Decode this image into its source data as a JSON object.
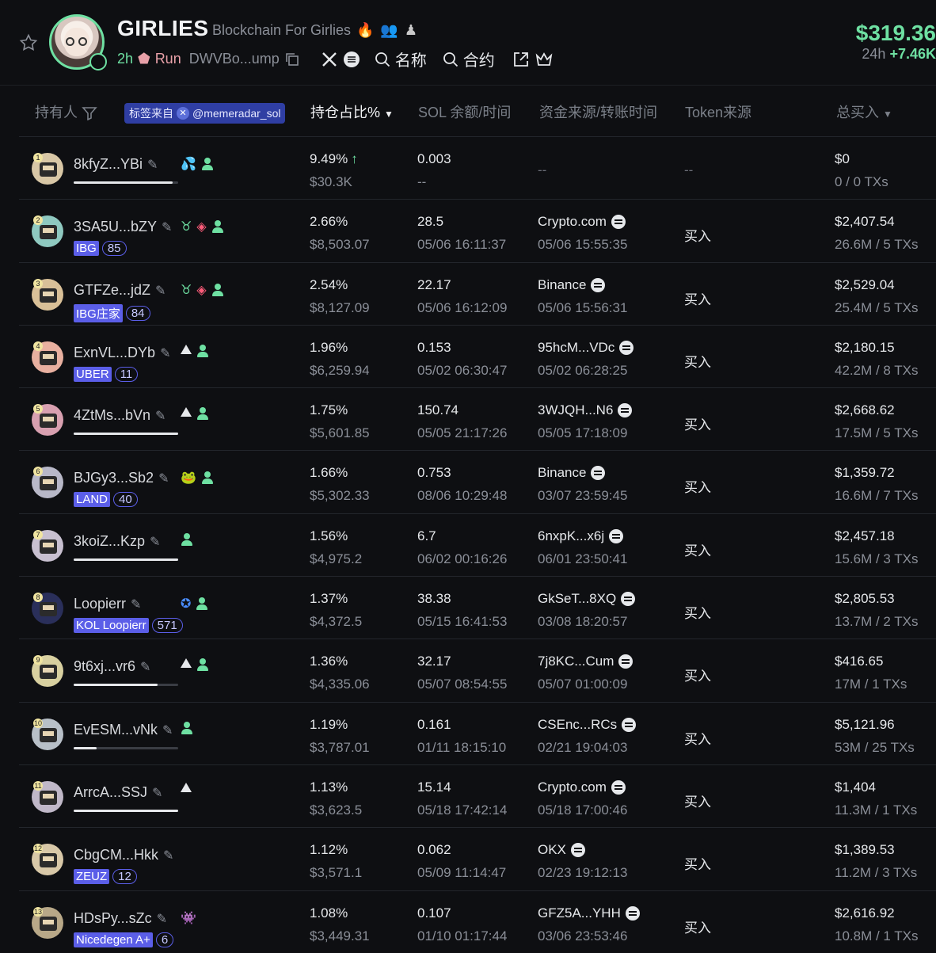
{
  "token": {
    "symbol": "GIRLIES",
    "full_name": "Blockchain For Girlies",
    "age": "2h",
    "run_label": "Run",
    "address": "DWVBo...ump",
    "search_name": "名称",
    "search_contract": "合约",
    "price": "$319.36",
    "change_label": "24h",
    "change_value": "+7.46K"
  },
  "columns": {
    "holder": "持有人",
    "tag_source": "标签来自",
    "tag_account": "@memeradar_sol",
    "holding_pct": "持仓占比%",
    "sol_balance": "SOL 余额/时间",
    "funding": "资金来源/转账时间",
    "token_source": "Token来源",
    "total_buy": "总买入"
  },
  "colors": {
    "accent": "#6ee0a2",
    "tag": "#5b5ee8",
    "bg": "#0e0f12"
  },
  "rows": [
    {
      "rank": "1",
      "name": "8kfyZ...YBi",
      "bar": 0.95,
      "badges": [
        "drops-icon",
        "person-icon"
      ],
      "tag": null,
      "tag_num": null,
      "pct": "9.49%",
      "pct_up": "↑",
      "value": "$30.3K",
      "sol": "0.003",
      "sol_time": "--",
      "src": "",
      "src_time": "",
      "src_dash": "--",
      "token_src": "--",
      "total": "$0",
      "txs": "0 / 0 TXs"
    },
    {
      "rank": "2",
      "name": "3SA5U...bZY",
      "bar": 1.0,
      "badges": [
        "bull-icon",
        "stack-icon",
        "person-icon"
      ],
      "tag": "IBG",
      "tag_num": "85",
      "pct": "2.66%",
      "pct_up": "",
      "value": "$8,503.07",
      "sol": "28.5",
      "sol_time": "05/06 16:11:37",
      "src": "Crypto.com",
      "src_time": "05/06 15:55:35",
      "src_dash": "",
      "token_src": "买入",
      "total": "$2,407.54",
      "txs": "26.6M / 5 TXs"
    },
    {
      "rank": "3",
      "name": "GTFZe...jdZ",
      "bar": 1.0,
      "badges": [
        "bull-icon",
        "stack-icon",
        "person-icon"
      ],
      "tag": "IBG庄家",
      "tag_num": "84",
      "pct": "2.54%",
      "pct_up": "",
      "value": "$8,127.09",
      "sol": "22.17",
      "sol_time": "05/06 16:12:09",
      "src": "Binance",
      "src_time": "05/06 15:56:31",
      "src_dash": "",
      "token_src": "买入",
      "total": "$2,529.04",
      "txs": "25.4M / 5 TXs"
    },
    {
      "rank": "4",
      "name": "ExnVL...DYb",
      "bar": 0.45,
      "badges": [
        "triangle-icon",
        "person-icon"
      ],
      "tag": "UBER",
      "tag_num": "11",
      "pct": "1.96%",
      "pct_up": "",
      "value": "$6,259.94",
      "sol": "0.153",
      "sol_time": "05/02 06:30:47",
      "src": "95hcM...VDc",
      "src_time": "05/02 06:28:25",
      "src_dash": "",
      "token_src": "买入",
      "total": "$2,180.15",
      "txs": "42.2M / 8 TXs"
    },
    {
      "rank": "5",
      "name": "4ZtMs...bVn",
      "bar": 1.0,
      "badges": [
        "triangle-icon",
        "person-icon"
      ],
      "tag": null,
      "tag_num": null,
      "pct": "1.75%",
      "pct_up": "",
      "value": "$5,601.85",
      "sol": "150.74",
      "sol_time": "05/05 21:17:26",
      "src": "3WJQH...N6",
      "src_time": "05/05 17:18:09",
      "src_dash": "",
      "token_src": "买入",
      "total": "$2,668.62",
      "txs": "17.5M / 5 TXs"
    },
    {
      "rank": "6",
      "name": "BJGy3...Sb2",
      "bar": 1.0,
      "badges": [
        "frog-icon",
        "person-icon"
      ],
      "tag": "LAND",
      "tag_num": "40",
      "pct": "1.66%",
      "pct_up": "",
      "value": "$5,302.33",
      "sol": "0.753",
      "sol_time": "08/06 10:29:48",
      "src": "Binance",
      "src_time": "03/07 23:59:45",
      "src_dash": "",
      "token_src": "买入",
      "total": "$1,359.72",
      "txs": "16.6M / 7 TXs"
    },
    {
      "rank": "7",
      "name": "3koiZ...Kzp",
      "bar": 1.0,
      "badges": [
        "person-icon"
      ],
      "tag": null,
      "tag_num": null,
      "pct": "1.56%",
      "pct_up": "",
      "value": "$4,975.2",
      "sol": "6.7",
      "sol_time": "06/02 00:16:26",
      "src": "6nxpK...x6j",
      "src_time": "06/01 23:50:41",
      "src_dash": "",
      "token_src": "买入",
      "total": "$2,457.18",
      "txs": "15.6M / 3 TXs"
    },
    {
      "rank": "8",
      "name": "Loopierr",
      "bar": 1.0,
      "badges": [
        "verified-icon",
        "person-icon"
      ],
      "tag": "KOL Loopierr",
      "tag_num": "571",
      "pct": "1.37%",
      "pct_up": "",
      "value": "$4,372.5",
      "sol": "38.38",
      "sol_time": "05/15 16:41:53",
      "src": "GkSeT...8XQ",
      "src_time": "03/08 18:20:57",
      "src_dash": "",
      "token_src": "买入",
      "total": "$2,805.53",
      "txs": "13.7M / 2 TXs"
    },
    {
      "rank": "9",
      "name": "9t6xj...vr6",
      "bar": 0.8,
      "badges": [
        "triangle-icon",
        "person-icon"
      ],
      "tag": null,
      "tag_num": null,
      "pct": "1.36%",
      "pct_up": "",
      "value": "$4,335.06",
      "sol": "32.17",
      "sol_time": "05/07 08:54:55",
      "src": "7j8KC...Cum",
      "src_time": "05/07 01:00:09",
      "src_dash": "",
      "token_src": "买入",
      "total": "$416.65",
      "txs": "17M / 1 TXs"
    },
    {
      "rank": "10",
      "name": "EvESM...vNk",
      "bar": 0.22,
      "badges": [
        "person-icon"
      ],
      "tag": null,
      "tag_num": null,
      "pct": "1.19%",
      "pct_up": "",
      "value": "$3,787.01",
      "sol": "0.161",
      "sol_time": "01/11 18:15:10",
      "src": "CSEnc...RCs",
      "src_time": "02/21 19:04:03",
      "src_dash": "",
      "token_src": "买入",
      "total": "$5,121.96",
      "txs": "53M / 25 TXs"
    },
    {
      "rank": "11",
      "name": "ArrcA...SSJ",
      "bar": 1.0,
      "badges": [
        "triangle-icon"
      ],
      "tag": null,
      "tag_num": null,
      "pct": "1.13%",
      "pct_up": "",
      "value": "$3,623.5",
      "sol": "15.14",
      "sol_time": "05/18 17:42:14",
      "src": "Crypto.com",
      "src_time": "05/18 17:00:46",
      "src_dash": "",
      "token_src": "买入",
      "total": "$1,404",
      "txs": "11.3M / 1 TXs"
    },
    {
      "rank": "12",
      "name": "CbgCM...Hkk",
      "bar": 1.0,
      "badges": [],
      "tag": "ZEUZ",
      "tag_num": "12",
      "pct": "1.12%",
      "pct_up": "",
      "value": "$3,571.1",
      "sol": "0.062",
      "sol_time": "05/09 11:14:47",
      "src": "OKX",
      "src_time": "02/23 19:12:13",
      "src_dash": "",
      "token_src": "买入",
      "total": "$1,389.53",
      "txs": "11.2M / 3 TXs"
    },
    {
      "rank": "13",
      "name": "HDsPy...sZc",
      "bar": 1.0,
      "badges": [
        "alien-icon"
      ],
      "tag": "Nicedegen A+",
      "tag_num": "6",
      "pct": "1.08%",
      "pct_up": "",
      "value": "$3,449.31",
      "sol": "0.107",
      "sol_time": "01/10 01:17:44",
      "src": "GFZ5A...YHH",
      "src_time": "03/06 23:53:46",
      "src_dash": "",
      "token_src": "买入",
      "total": "$2,616.92",
      "txs": "10.8M / 1 TXs"
    }
  ]
}
